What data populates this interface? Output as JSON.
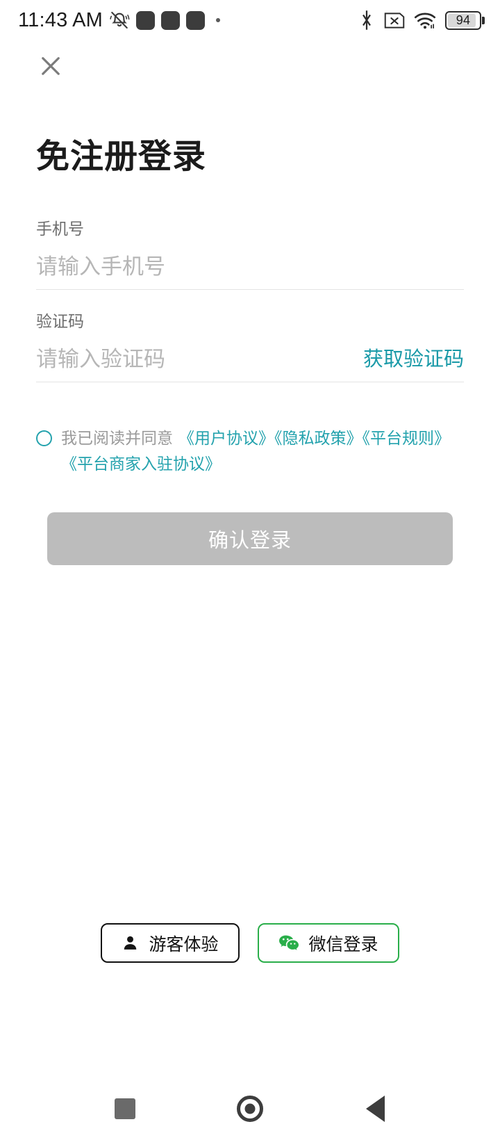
{
  "status_bar": {
    "clock": "11:43 AM",
    "left_icons": [
      "bell-muted-icon",
      "blob-placeholder",
      "blob-placeholder",
      "blob-placeholder",
      "dot-indicator"
    ],
    "right_icons": [
      "bluetooth-icon",
      "sim-card-missing-icon",
      "wifi-icon",
      "battery-icon"
    ],
    "battery_level": "94"
  },
  "top_bar": {
    "close_icon": "close-icon"
  },
  "page": {
    "title": "免注册登录"
  },
  "form": {
    "phone": {
      "label": "手机号",
      "placeholder": "请输入手机号",
      "value": ""
    },
    "code": {
      "label": "验证码",
      "placeholder": "请输入验证码",
      "value": "",
      "send_label": "获取验证码"
    }
  },
  "agreement": {
    "checked": false,
    "lead_text": "我已阅读并同意",
    "links": [
      "《用户协议》",
      "《隐私政策》",
      "《平台规则》",
      "《平台商家入驻协议》"
    ]
  },
  "submit": {
    "label": "确认登录",
    "enabled": false
  },
  "alt_logins": [
    {
      "label": "游客体验",
      "icon": "person-icon"
    },
    {
      "label": "微信登录",
      "icon": "wechat-icon"
    }
  ],
  "nav_bar": {
    "buttons": [
      "recents-square-icon",
      "home-circle-icon",
      "back-triangle-icon"
    ]
  },
  "colors": {
    "accent_teal": "#23a2ad",
    "link_teal": "#1a9aa8",
    "wechat_green": "#2aae4a",
    "disabled_gray": "#bcbcbc",
    "placeholder_gray": "#b6b6b6",
    "label_gray": "#6d6d6d",
    "title_black": "#1b1b1b"
  }
}
